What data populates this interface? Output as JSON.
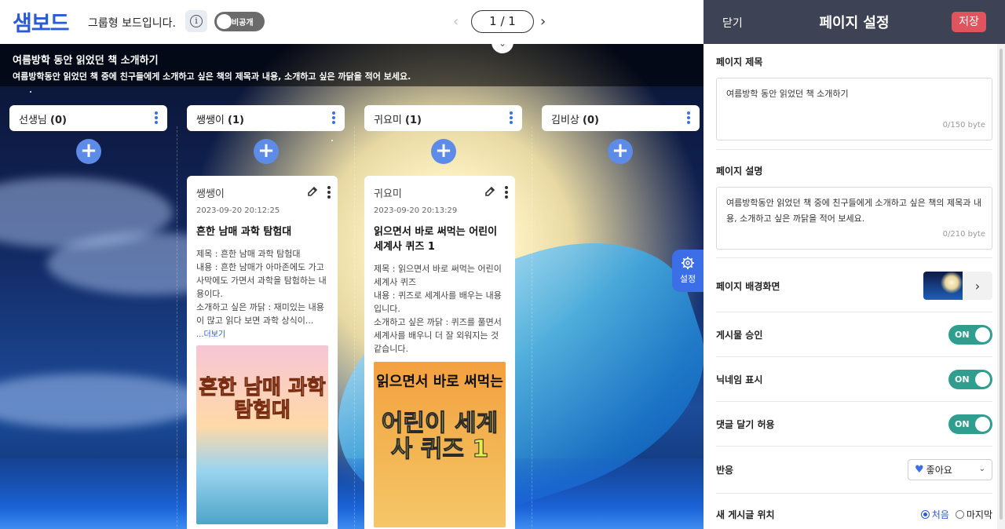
{
  "header": {
    "logo": "샘보드",
    "board_type": "그룹형 보드입니다.",
    "info_symbol": "i",
    "private_label": "비공개",
    "pagination": {
      "prev": "‹",
      "current": "1 / 1",
      "next": "›"
    },
    "collapse_symbol": "⌄"
  },
  "board": {
    "title": "여름방학 동안 읽었던 책 소개하기",
    "description": "여름방학동안 읽었던 책 중에 친구들에게 소개하고 싶은 책의 제목과 내용, 소개하고 싶은 까닭을 적어 보세요.",
    "columns": [
      {
        "name": "선생님",
        "count": "(0)"
      },
      {
        "name": "쌩쌩이",
        "count": "(1)"
      },
      {
        "name": "귀요미",
        "count": "(1)"
      },
      {
        "name": "김비상",
        "count": "(0)"
      }
    ],
    "add_symbol": "+",
    "cards": [
      {
        "author": "쌩쌩이",
        "date": "2023-09-20 20:12:25",
        "title": "흔한 남매 과학 탐험대",
        "body": "제목 : 흔한 남매 과학 탐험대\n내용 : 흔한 남매가 아마존에도 가고 사막에도 가면서 과학을 탐험하는 내용이다.\n소개하고 싶은 까닭 : 재미있는 내용이 많고 읽다 보면 과학 상식이...",
        "more": "...더보기",
        "cover_title": "흔한 남매 과학 탐험대"
      },
      {
        "author": "귀요미",
        "date": "2023-09-20 20:13:29",
        "title": "읽으면서 바로 써먹는 어린이 세계사 퀴즈 1",
        "body": "제목 : 읽으면서 바로 써먹는 어린이 세계사 퀴즈\n내용 : 퀴즈로 세계사를 배우는 내용입니다.\n소개하고 싶은 까닭 : 퀴즈를 풀면서 세계사를 배우니 더 잘 외워지는 것 같습니다.",
        "cover_title_top": "읽으면서 바로 써먹는",
        "cover_title_main": "어린이 세계사 퀴즈 1"
      }
    ],
    "settings_fab_label": "설정"
  },
  "panel": {
    "close": "닫기",
    "title": "페이지 설정",
    "save": "저장",
    "page_title_label": "페이지 제목",
    "page_title_value": "여름방학 동안 읽었던 책 소개하기",
    "page_title_counter": "0/150 byte",
    "page_desc_label": "페이지 설명",
    "page_desc_value": "여름방학동안 읽었던 책 중에 친구들에게 소개하고 싶은 책의 제목과 내용, 소개하고 싶은 까닭을 적어 보세요.",
    "page_desc_counter": "0/210 byte",
    "bg_label": "페이지 배경화면",
    "bg_next": "›",
    "approve_label": "게시물 승인",
    "nickname_label": "닉네임 표시",
    "comments_label": "댓글 달기 허용",
    "toggle_on": "ON",
    "reaction_label": "반응",
    "reaction_value": "좋아요",
    "reaction_heart": "♥",
    "reaction_caret": "⌄",
    "new_post_label": "새 게시글 위치",
    "position_first": "처음",
    "position_last": "마지막"
  }
}
